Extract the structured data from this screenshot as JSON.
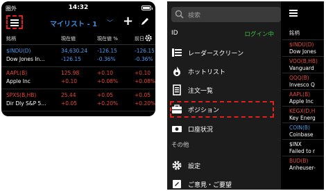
{
  "left": {
    "status": {
      "carrier": "圏外",
      "time": "14:32"
    },
    "toolbar": {
      "watchlist_title": "マイリスト - 1"
    },
    "table": {
      "headers": [
        "銘柄",
        "現在値",
        "現在値 %",
        "前日"
      ],
      "rows": [
        {
          "symbol": "$INDU(D)",
          "name": "Dow Jones In...",
          "price": "34,630.24",
          "change": "-126.15",
          "pct": "-126.15",
          "pct_change": "-0.36%",
          "prev": "-126.15",
          "prev2": "-0.36%",
          "sym_color": "blue",
          "val_color": "blue"
        },
        {
          "symbol": "AAPL(B)",
          "name": "Apple Inc",
          "price": "125.98",
          "change": "+0.10",
          "pct": "+0.10",
          "pct_change": "+0.08%",
          "prev": "+0.10",
          "prev2": "+0.08%",
          "sym_color": "red",
          "val_color": "red"
        },
        {
          "symbol": "SPXS(B,HB)",
          "name": "Dir Dly S&P 5...",
          "price": "25.44",
          "change": "+0.05",
          "pct": "+0.05",
          "pct_change": "+0.20%",
          "prev": "+0.05",
          "prev2": "+0.20%",
          "sym_color": "red",
          "val_color": "red"
        }
      ]
    }
  },
  "right": {
    "search_placeholder": "検索",
    "id_label": "ID",
    "login_status": "ログイン中",
    "menu_items": [
      {
        "label": "レーダースクリーン",
        "icon": "radar-screen-icon"
      },
      {
        "label": "ホットリスト",
        "icon": "flame-icon"
      },
      {
        "label": "注文一覧",
        "icon": "order-list-icon"
      },
      {
        "label": "ポジション",
        "icon": "briefcase-icon"
      },
      {
        "label": "口座状況",
        "icon": "money-icon"
      }
    ],
    "section_other": "その他",
    "other_items": [
      {
        "label": "設定",
        "icon": "gear-icon"
      },
      {
        "label": "ご意見・ご要望",
        "icon": "feedback-icon"
      }
    ],
    "behind_list": {
      "header": "銘柄",
      "items": [
        {
          "symbol": "$INDU(D)",
          "name": "Dow Jones",
          "color": "red"
        },
        {
          "symbol": "VOO(B,HB)",
          "name": "Vanguard",
          "color": "red"
        },
        {
          "symbol": "QQQ(B)",
          "name": "Invesco Q",
          "color": "red"
        },
        {
          "symbol": "AAPL(B)",
          "name": "Apple Inc",
          "color": "red"
        },
        {
          "symbol": "KEGX(D,H",
          "name": "Key Energ",
          "color": "red"
        },
        {
          "symbol": "COIN(B)",
          "name": "Coinbase",
          "color": "blue"
        },
        {
          "symbol": "$INX",
          "name": "Failed to r",
          "color": "white"
        },
        {
          "symbol": "BUD(B)",
          "name": "Anheuser-",
          "color": "red"
        }
      ]
    }
  },
  "colors": {
    "accent_blue": "#3a8dde",
    "negative": "#4a9be8",
    "positive": "#e4473a",
    "login_green": "#3fbf3f",
    "highlight": "#e4201e"
  },
  "status_battery_level": 0.85
}
